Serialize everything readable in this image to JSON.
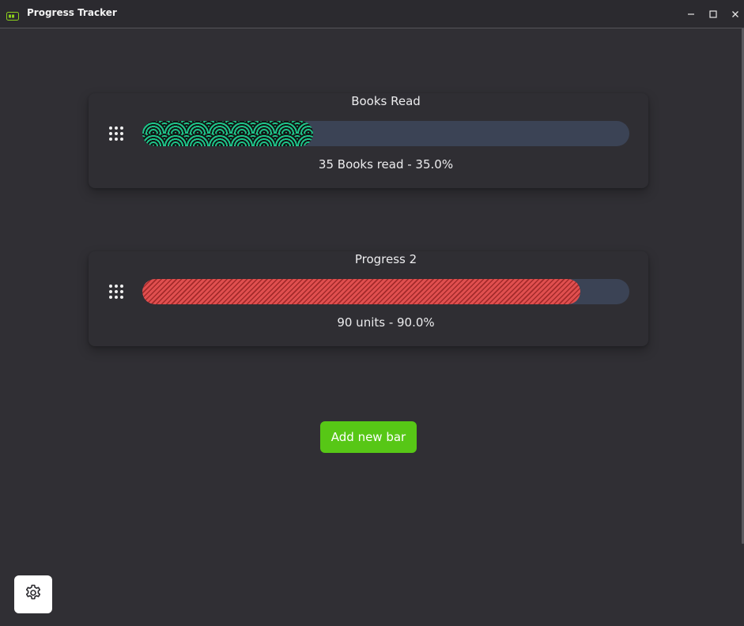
{
  "window": {
    "title": "Progress Tracker",
    "icon": "battery-icon",
    "controls": [
      "minimize-icon",
      "maximize-icon",
      "close-icon"
    ]
  },
  "bars": [
    {
      "title": "Books Read",
      "caption": "35 Books read - 35.0%",
      "progress_percent": 35.0,
      "pattern": "seigaiha-waves",
      "color": "#18b07e"
    },
    {
      "title": "Progress 2",
      "caption": "90 units - 90.0%",
      "progress_percent": 90.0,
      "pattern": "diagonal-stripes",
      "color": "#d54545"
    }
  ],
  "actions": {
    "add_label": "Add new bar",
    "settings_icon": "gear-icon"
  },
  "colors": {
    "background": "#302f34",
    "track": "#3b4355",
    "accent": "#57c716"
  }
}
